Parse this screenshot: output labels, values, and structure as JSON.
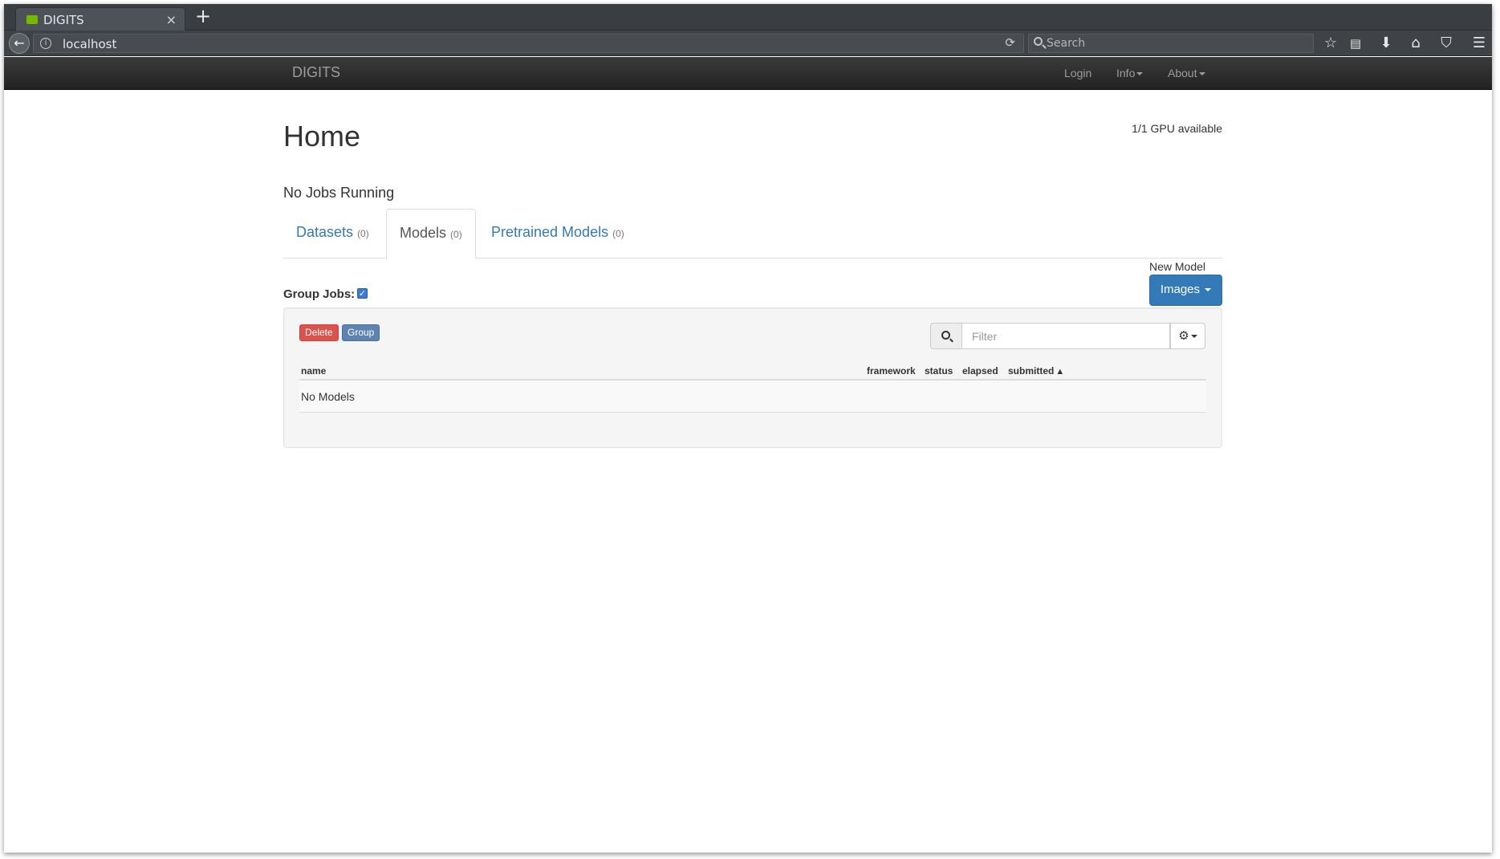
{
  "browser": {
    "tab_title": "DIGITS",
    "tab_close_glyph": "×",
    "new_tab_glyph": "+",
    "back_glyph": "←",
    "info_glyph": "i",
    "url": "localhost",
    "reload_glyph": "⟳",
    "search_placeholder": "Search",
    "toolbar_icons": [
      "bookmark-star-icon",
      "reading-list-icon",
      "download-icon",
      "home-icon",
      "pocket-icon",
      "menu-icon"
    ]
  },
  "navbar": {
    "brand": "DIGITS",
    "links": [
      "Login",
      "Info",
      "About"
    ]
  },
  "page": {
    "title": "Home",
    "gpu_status": "1/1 GPU available",
    "jobs_status": "No Jobs Running"
  },
  "tabs": [
    {
      "label": "Datasets",
      "count": "(0)"
    },
    {
      "label": "Models",
      "count": "(0)"
    },
    {
      "label": "Pretrained Models",
      "count": "(0)"
    }
  ],
  "new_model": {
    "label": "New Model",
    "button": "Images"
  },
  "group_jobs": {
    "label": "Group Jobs:",
    "checked": true
  },
  "toolbar": {
    "delete_label": "Delete",
    "group_label": "Group",
    "filter_placeholder": "Filter"
  },
  "table": {
    "columns": [
      "name",
      "framework",
      "status",
      "elapsed",
      "submitted"
    ],
    "empty_message": "No Models"
  },
  "colors": {
    "primary": "#337ab7",
    "danger": "#d9534f",
    "navbar_bg": "#222222"
  }
}
